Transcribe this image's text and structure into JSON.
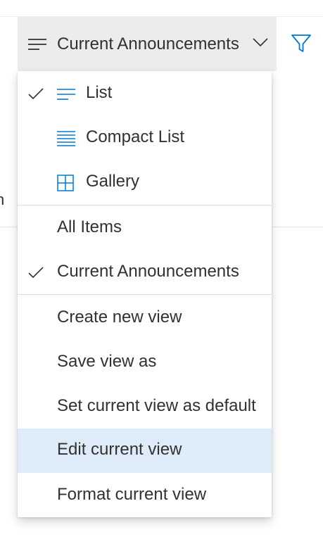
{
  "header": {
    "view_name": "Current Announcements",
    "view_icon": "lines-icon",
    "chevron_icon": "chevron-down-icon",
    "filter_icon": "filter-icon"
  },
  "background": {
    "column_stub_text": "n"
  },
  "menu": {
    "layout_items": [
      {
        "label": "List",
        "icon": "list-icon",
        "checked": true
      },
      {
        "label": "Compact List",
        "icon": "compact-list-icon",
        "checked": false
      },
      {
        "label": "Gallery",
        "icon": "gallery-icon",
        "checked": false
      }
    ],
    "view_items": [
      {
        "label": "All Items",
        "checked": false
      },
      {
        "label": "Current Announcements",
        "checked": true
      }
    ],
    "action_items": [
      {
        "label": "Create new view",
        "highlighted": false
      },
      {
        "label": "Save view as",
        "highlighted": false
      },
      {
        "label": "Set current view as default",
        "highlighted": false
      },
      {
        "label": "Edit current view",
        "highlighted": true
      },
      {
        "label": "Format current view",
        "highlighted": false
      }
    ]
  },
  "colors": {
    "accent": "#0078d4",
    "highlight": "#deecf9",
    "text": "#323130",
    "switcher_bg": "#ececec"
  }
}
